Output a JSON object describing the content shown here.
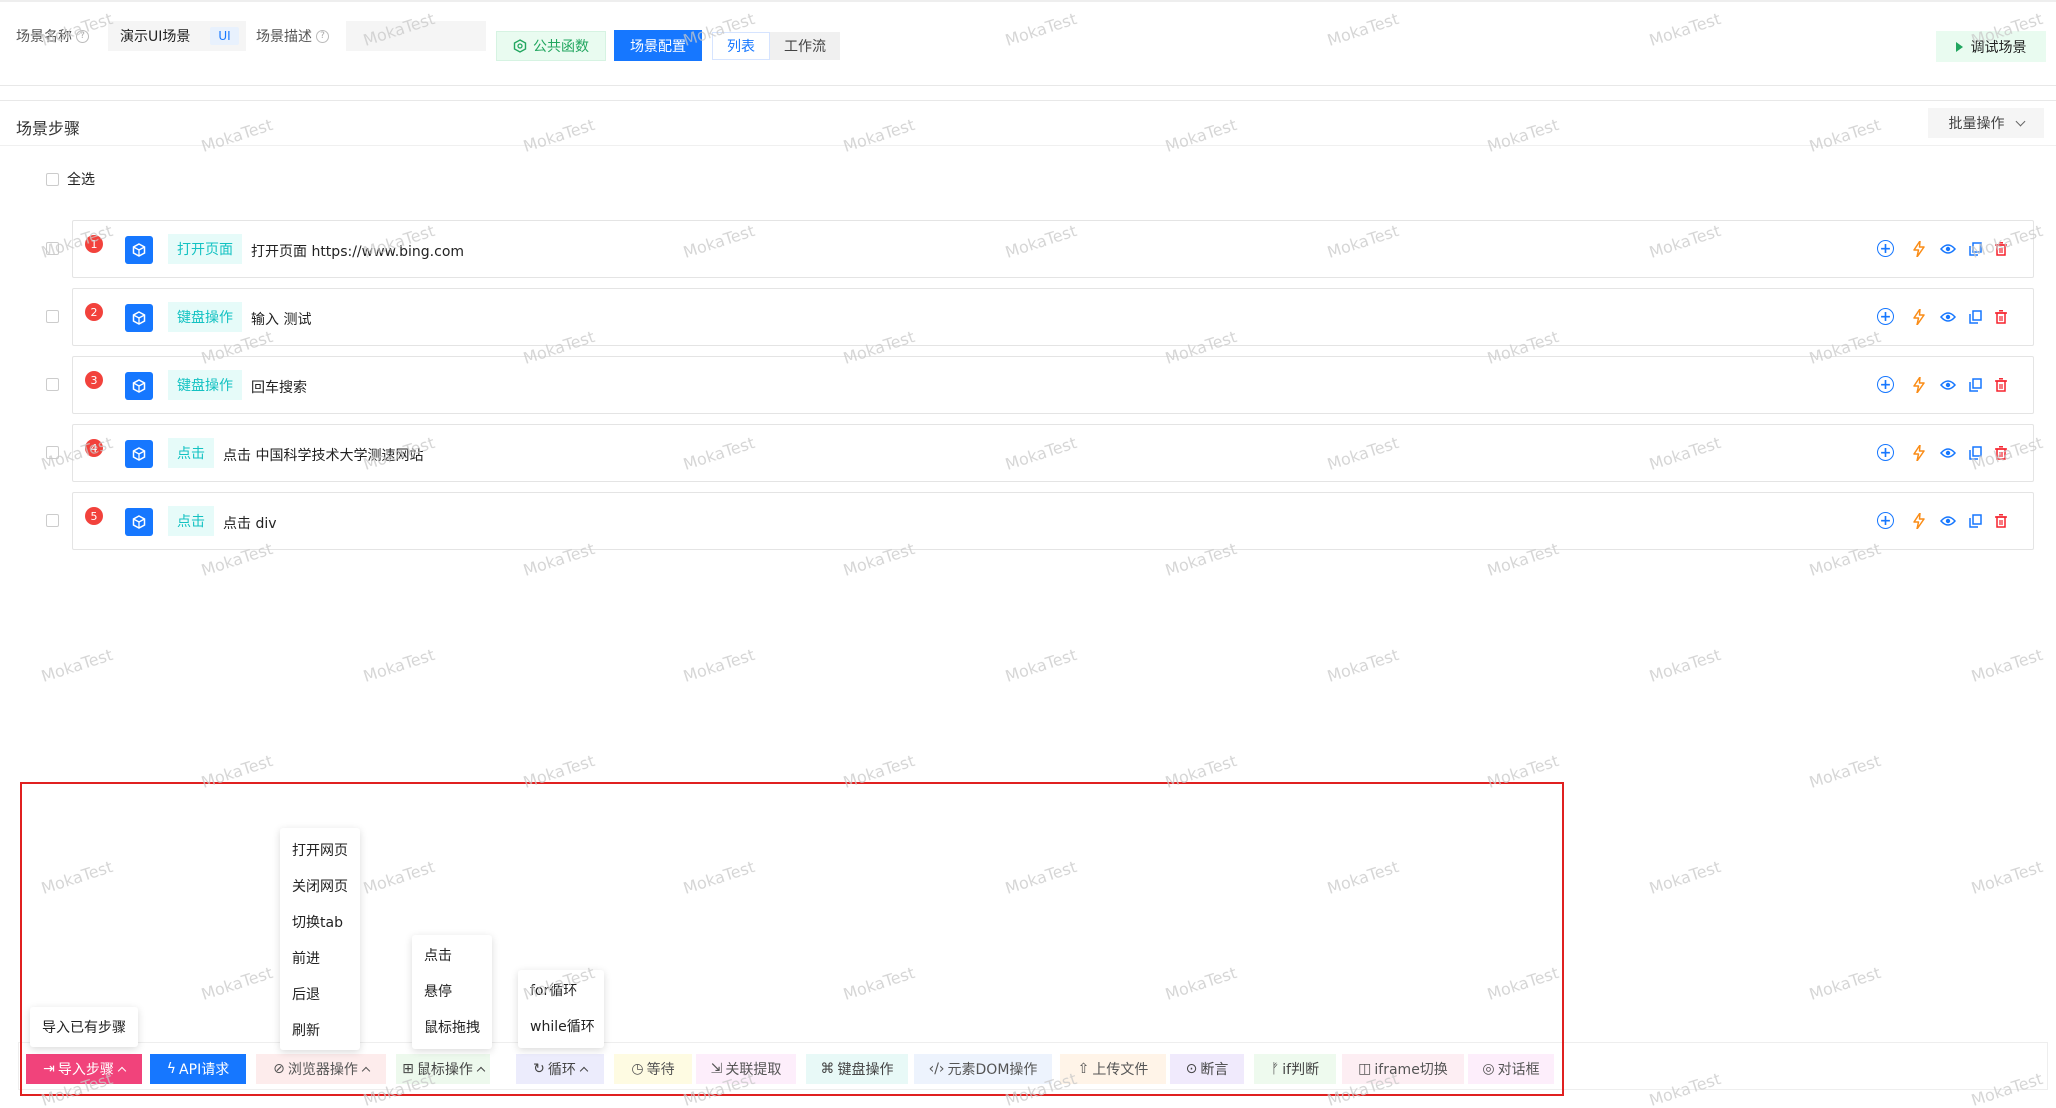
{
  "header": {
    "name_label": "场景名称",
    "name_value": "演示UI场景",
    "ui_tag": "UI",
    "desc_label": "场景描述",
    "public_func": "公共函数",
    "config_btn": "场景配置",
    "view_list": "列表",
    "view_flow": "工作流",
    "debug_btn": "调试场景"
  },
  "steps": {
    "title": "场景步骤",
    "batch": "批量操作",
    "select_all": "全选",
    "items": [
      {
        "num": "1",
        "type": "打开页面",
        "text": "打开页面 https://www.bing.com"
      },
      {
        "num": "2",
        "type": "键盘操作",
        "text": "输入 测试"
      },
      {
        "num": "3",
        "type": "键盘操作",
        "text": "回车搜索"
      },
      {
        "num": "4",
        "type": "点击",
        "text": "点击 中国科学技术大学测速网站"
      },
      {
        "num": "5",
        "type": "点击",
        "text": "点击 div"
      }
    ]
  },
  "toolbar": {
    "import": "导入步骤",
    "api": "API请求",
    "browser": "浏览器操作",
    "mouse": "鼠标操作",
    "loop": "循环",
    "wait": "等待",
    "extract": "关联提取",
    "keyboard": "键盘操作",
    "dom": "元素DOM操作",
    "upload": "上传文件",
    "assert": "断言",
    "if": "if判断",
    "iframe": "iframe切换",
    "dialog": "对话框"
  },
  "popups": {
    "import_menu": [
      "导入已有步骤"
    ],
    "browser_menu": [
      "打开网页",
      "关闭网页",
      "切换tab",
      "前进",
      "后退",
      "刷新"
    ],
    "mouse_menu": [
      "点击",
      "悬停",
      "鼠标拖拽"
    ],
    "loop_menu": [
      "for循环",
      "while循环"
    ]
  },
  "watermark": "MokaTest",
  "colors": {
    "primary": "#1677ff",
    "green": "#21a65f",
    "badge": "#f2423c",
    "tag": "#13c2c2",
    "frame": "#e02020"
  }
}
